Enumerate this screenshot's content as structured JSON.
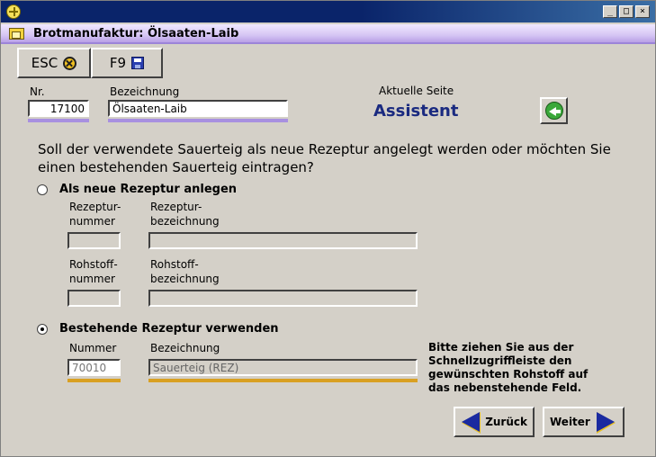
{
  "window": {
    "controls": {
      "minimize": "_",
      "maximize": "□",
      "close": "×"
    }
  },
  "document": {
    "title": "Brotmanufaktur: Ölsaaten-Laib"
  },
  "toolbar": {
    "esc_label": "ESC",
    "f9_label": "F9"
  },
  "header": {
    "nr_label": "Nr.",
    "nr_value": "17100",
    "bezeichnung_label": "Bezeichnung",
    "bezeichnung_value": "Ölsaaten-Laib",
    "page_label": "Aktuelle Seite",
    "page_value": "Assistent"
  },
  "question": "Soll der verwendete Sauerteig als neue Rezeptur angelegt werden oder möchten Sie einen bestehenden Sauerteig eintragen?",
  "option_new": {
    "label": "Als neue Rezeptur anlegen",
    "checked": false,
    "rez_nr_label_1": "Rezeptur-",
    "rez_nr_label_2": "nummer",
    "rez_bez_label_1": "Rezeptur-",
    "rez_bez_label_2": "bezeichnung",
    "roh_nr_label_1": "Rohstoff-",
    "roh_nr_label_2": "nummer",
    "roh_bez_label_1": "Rohstoff-",
    "roh_bez_label_2": "bezeichnung",
    "rez_nr_value": "",
    "rez_bez_value": "",
    "roh_nr_value": "",
    "roh_bez_value": ""
  },
  "option_existing": {
    "label": "Bestehende Rezeptur verwenden",
    "checked": true,
    "nummer_label": "Nummer",
    "bezeichnung_label": "Bezeichnung",
    "nummer_value": "70010",
    "bezeichnung_value": "Sauerteig (REZ)",
    "hint_1": "Bitte ziehen Sie aus der",
    "hint_2": "Schnellzugriffleiste den",
    "hint_3": "gewünschten Rohstoff auf",
    "hint_4": "das nebenstehende Feld."
  },
  "nav": {
    "back_label": "Zurück",
    "next_label": "Weiter"
  },
  "colors": {
    "accent_purple": "#a890e0",
    "accent_gold": "#d9a022",
    "title_blue": "#0a246a",
    "arrow_blue": "#1a2aa0"
  },
  "icons": {
    "app": "app-logo-icon",
    "document": "folder-icon",
    "esc": "cancel-icon",
    "f9": "save-disk-icon",
    "back": "green-back-arrow-icon",
    "prev": "arrow-left-icon",
    "next": "arrow-right-icon"
  }
}
